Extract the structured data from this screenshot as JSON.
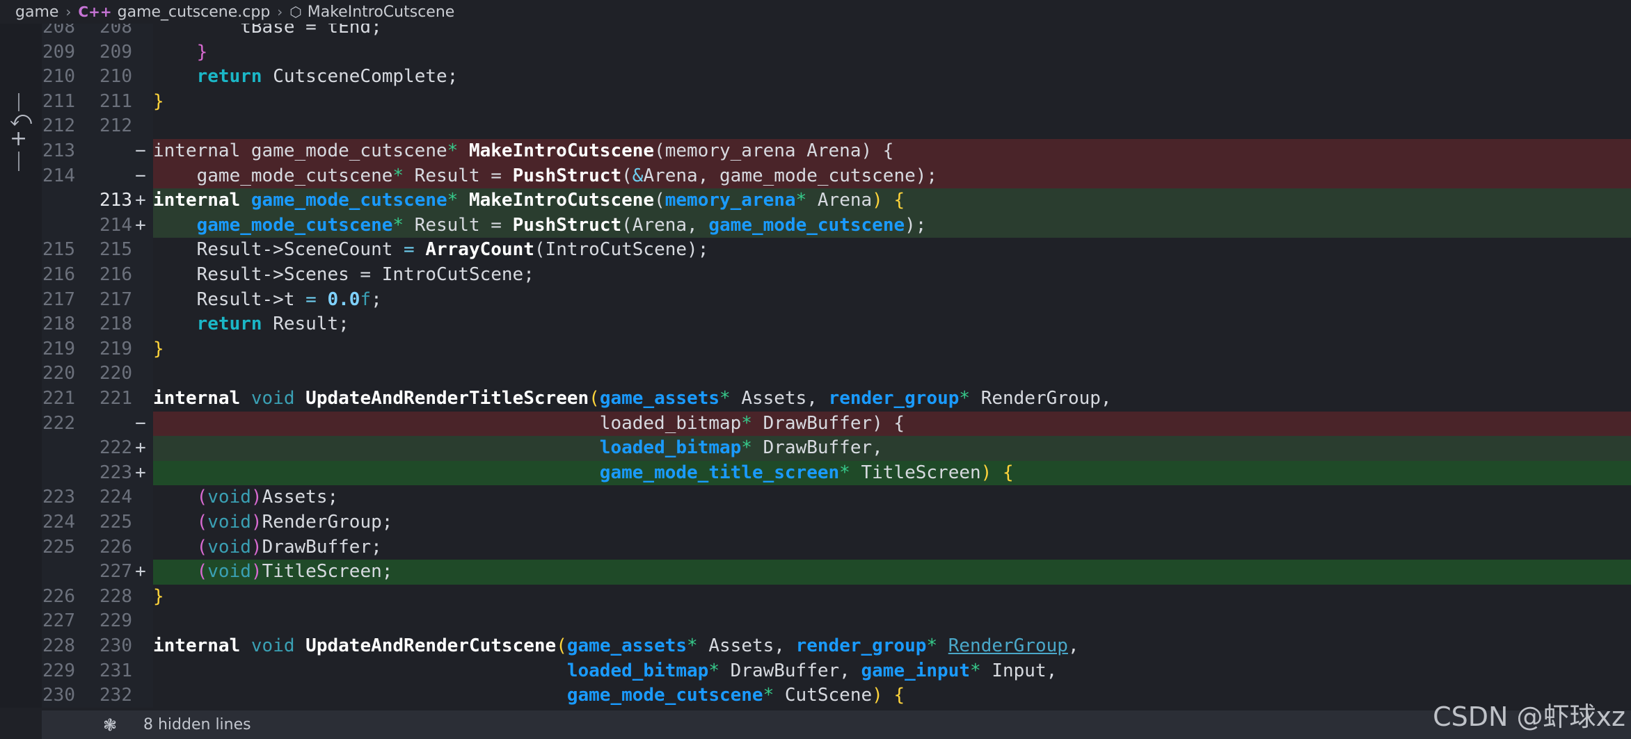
{
  "breadcrumb": {
    "root": "game",
    "file_icon": "C++",
    "file": "game_cutscene.cpp",
    "symbol": "MakeIntroCutscene"
  },
  "lines": [
    {
      "old": "208",
      "new": "208",
      "mark": "",
      "type": "ctx",
      "tokens": [
        [
          "",
          "        tBase = tEnd;"
        ]
      ]
    },
    {
      "old": "209",
      "new": "209",
      "mark": "",
      "type": "ctx",
      "tokens": [
        [
          "",
          "    "
        ],
        [
          "pbr",
          "}"
        ]
      ]
    },
    {
      "old": "210",
      "new": "210",
      "mark": "",
      "type": "ctx",
      "tokens": [
        [
          "",
          "    "
        ],
        [
          "kwt",
          "return"
        ],
        [
          "",
          " CutsceneComplete;"
        ]
      ]
    },
    {
      "old": "211",
      "new": "211",
      "mark": "",
      "type": "ctx",
      "tokens": [
        [
          "br",
          "}"
        ]
      ]
    },
    {
      "old": "212",
      "new": "212",
      "mark": "",
      "type": "ctx",
      "tokens": [
        [
          "",
          ""
        ]
      ]
    },
    {
      "old": "213",
      "new": "",
      "mark": "−",
      "type": "del",
      "tokens": [
        [
          "",
          "internal game_mode_cutscene"
        ],
        [
          "star",
          "*"
        ],
        [
          "",
          " "
        ],
        [
          "fn",
          "MakeIntroCutscene"
        ],
        [
          "",
          "(memory_arena Arena) {"
        ]
      ]
    },
    {
      "old": "214",
      "new": "",
      "mark": "−",
      "type": "del",
      "tokens": [
        [
          "",
          "    game_mode_cutscene"
        ],
        [
          "star",
          "*"
        ],
        [
          "",
          " Result = "
        ],
        [
          "fn",
          "PushStruct"
        ],
        [
          "",
          "("
        ],
        [
          "op",
          "&"
        ],
        [
          "",
          "Arena, game_mode_cutscene);"
        ]
      ]
    },
    {
      "old": "",
      "new": "213",
      "mark": "+",
      "type": "add",
      "cur": true,
      "tokens": [
        [
          "kwb",
          "internal"
        ],
        [
          "",
          " "
        ],
        [
          "ty",
          "game_mode_cutscene"
        ],
        [
          "star",
          "*"
        ],
        [
          "",
          " "
        ],
        [
          "fn",
          "MakeIntroCutscene"
        ],
        [
          "",
          "("
        ],
        [
          "ty",
          "memory_arena"
        ],
        [
          "star",
          "*"
        ],
        [
          "",
          " Arena"
        ],
        [
          "br",
          ")"
        ],
        [
          "",
          " "
        ],
        [
          "br",
          "{"
        ]
      ]
    },
    {
      "old": "",
      "new": "214",
      "mark": "+",
      "type": "add",
      "tokens": [
        [
          "",
          "    "
        ],
        [
          "ty",
          "game_mode_cutscene"
        ],
        [
          "star",
          "*"
        ],
        [
          "",
          " Result = "
        ],
        [
          "fn",
          "PushStruct"
        ],
        [
          "",
          "(Arena, "
        ],
        [
          "ty",
          "game_mode_cutscene"
        ],
        [
          "",
          "); "
        ]
      ]
    },
    {
      "old": "215",
      "new": "215",
      "mark": "",
      "type": "ctx",
      "tokens": [
        [
          "",
          "    Result->SceneCount "
        ],
        [
          "op",
          "="
        ],
        [
          "",
          " "
        ],
        [
          "fn",
          "ArrayCount"
        ],
        [
          "",
          "(IntroCutScene);"
        ]
      ]
    },
    {
      "old": "216",
      "new": "216",
      "mark": "",
      "type": "ctx",
      "tokens": [
        [
          "",
          "    Result->Scenes = IntroCutScene;"
        ]
      ]
    },
    {
      "old": "217",
      "new": "217",
      "mark": "",
      "type": "ctx",
      "tokens": [
        [
          "",
          "    Result->t "
        ],
        [
          "op",
          "="
        ],
        [
          "",
          " "
        ],
        [
          "num",
          "0.0"
        ],
        [
          "vd",
          "f"
        ],
        [
          "",
          ";"
        ]
      ]
    },
    {
      "old": "218",
      "new": "218",
      "mark": "",
      "type": "ctx",
      "tokens": [
        [
          "",
          "    "
        ],
        [
          "kwt",
          "return"
        ],
        [
          "",
          " Result;"
        ]
      ]
    },
    {
      "old": "219",
      "new": "219",
      "mark": "",
      "type": "ctx",
      "tokens": [
        [
          "br",
          "}"
        ]
      ]
    },
    {
      "old": "220",
      "new": "220",
      "mark": "",
      "type": "ctx",
      "tokens": [
        [
          "",
          ""
        ]
      ]
    },
    {
      "old": "221",
      "new": "221",
      "mark": "",
      "type": "ctx",
      "tokens": [
        [
          "kwb",
          "internal"
        ],
        [
          "",
          " "
        ],
        [
          "vd",
          "void"
        ],
        [
          "",
          " "
        ],
        [
          "fn",
          "UpdateAndRenderTitleScreen"
        ],
        [
          "br",
          "("
        ],
        [
          "ty",
          "game_assets"
        ],
        [
          "star",
          "*"
        ],
        [
          "",
          " Assets, "
        ],
        [
          "ty",
          "render_group"
        ],
        [
          "star",
          "*"
        ],
        [
          "",
          " RenderGroup,"
        ]
      ]
    },
    {
      "old": "222",
      "new": "",
      "mark": "−",
      "type": "del",
      "tokens": [
        [
          "",
          "                                         loaded_bitmap"
        ],
        [
          "star",
          "*"
        ],
        [
          "",
          " DrawBuffer) {"
        ]
      ]
    },
    {
      "old": "",
      "new": "222",
      "mark": "+",
      "type": "add",
      "tokens": [
        [
          "",
          "                                         "
        ],
        [
          "ty",
          "loaded_bitmap"
        ],
        [
          "star",
          "*"
        ],
        [
          "",
          " DrawBuffer,"
        ]
      ]
    },
    {
      "old": "",
      "new": "223",
      "mark": "+",
      "type": "addstrong",
      "tokens": [
        [
          "",
          "                                         "
        ],
        [
          "ty",
          "game_mode_title_screen"
        ],
        [
          "star",
          "*"
        ],
        [
          "",
          " TitleScreen"
        ],
        [
          "br",
          ")"
        ],
        [
          "",
          " "
        ],
        [
          "br",
          "{"
        ]
      ]
    },
    {
      "old": "223",
      "new": "224",
      "mark": "",
      "type": "ctx",
      "tokens": [
        [
          "",
          "    "
        ],
        [
          "pbr",
          "("
        ],
        [
          "vd",
          "void"
        ],
        [
          "pbr",
          ")"
        ],
        [
          "",
          "Assets;"
        ]
      ]
    },
    {
      "old": "224",
      "new": "225",
      "mark": "",
      "type": "ctx",
      "tokens": [
        [
          "",
          "    "
        ],
        [
          "pbr",
          "("
        ],
        [
          "vd",
          "void"
        ],
        [
          "pbr",
          ")"
        ],
        [
          "",
          "RenderGroup;"
        ]
      ]
    },
    {
      "old": "225",
      "new": "226",
      "mark": "",
      "type": "ctx",
      "tokens": [
        [
          "",
          "    "
        ],
        [
          "pbr",
          "("
        ],
        [
          "vd",
          "void"
        ],
        [
          "pbr",
          ")"
        ],
        [
          "",
          "DrawBuffer;"
        ]
      ]
    },
    {
      "old": "",
      "new": "227",
      "mark": "+",
      "type": "addstrong",
      "tokens": [
        [
          "",
          "    "
        ],
        [
          "pbr",
          "("
        ],
        [
          "vd",
          "void"
        ],
        [
          "pbr",
          ")"
        ],
        [
          "",
          "TitleScreen;"
        ]
      ]
    },
    {
      "old": "226",
      "new": "228",
      "mark": "",
      "type": "ctx",
      "tokens": [
        [
          "br",
          "}"
        ]
      ]
    },
    {
      "old": "227",
      "new": "229",
      "mark": "",
      "type": "ctx",
      "tokens": [
        [
          "",
          ""
        ]
      ]
    },
    {
      "old": "228",
      "new": "230",
      "mark": "",
      "type": "ctx",
      "tokens": [
        [
          "kwb",
          "internal"
        ],
        [
          "",
          " "
        ],
        [
          "vd",
          "void"
        ],
        [
          "",
          " "
        ],
        [
          "fn",
          "UpdateAndRenderCutscene"
        ],
        [
          "br",
          "("
        ],
        [
          "ty",
          "game_assets"
        ],
        [
          "star",
          "*"
        ],
        [
          "",
          " Assets, "
        ],
        [
          "ty",
          "render_group"
        ],
        [
          "star",
          "*"
        ],
        [
          "",
          " "
        ],
        [
          "und",
          "RenderGroup"
        ],
        [
          "",
          ","
        ]
      ]
    },
    {
      "old": "229",
      "new": "231",
      "mark": "",
      "type": "ctx",
      "tokens": [
        [
          "",
          "                                      "
        ],
        [
          "ty",
          "loaded_bitmap"
        ],
        [
          "star",
          "*"
        ],
        [
          "",
          " DrawBuffer, "
        ],
        [
          "ty",
          "game_input"
        ],
        [
          "star",
          "*"
        ],
        [
          "",
          " Input,"
        ]
      ]
    },
    {
      "old": "230",
      "new": "232",
      "mark": "",
      "type": "ctx",
      "tokens": [
        [
          "",
          "                                      "
        ],
        [
          "ty",
          "game_mode_cutscene"
        ],
        [
          "star",
          "*"
        ],
        [
          "",
          " CutScene"
        ],
        [
          "br",
          ")"
        ],
        [
          "",
          " "
        ],
        [
          "br",
          "{"
        ]
      ]
    }
  ],
  "hidden": {
    "label": "8 hidden lines",
    "icon": "unfold-icon"
  },
  "watermark": "CSDN @虾球xz"
}
